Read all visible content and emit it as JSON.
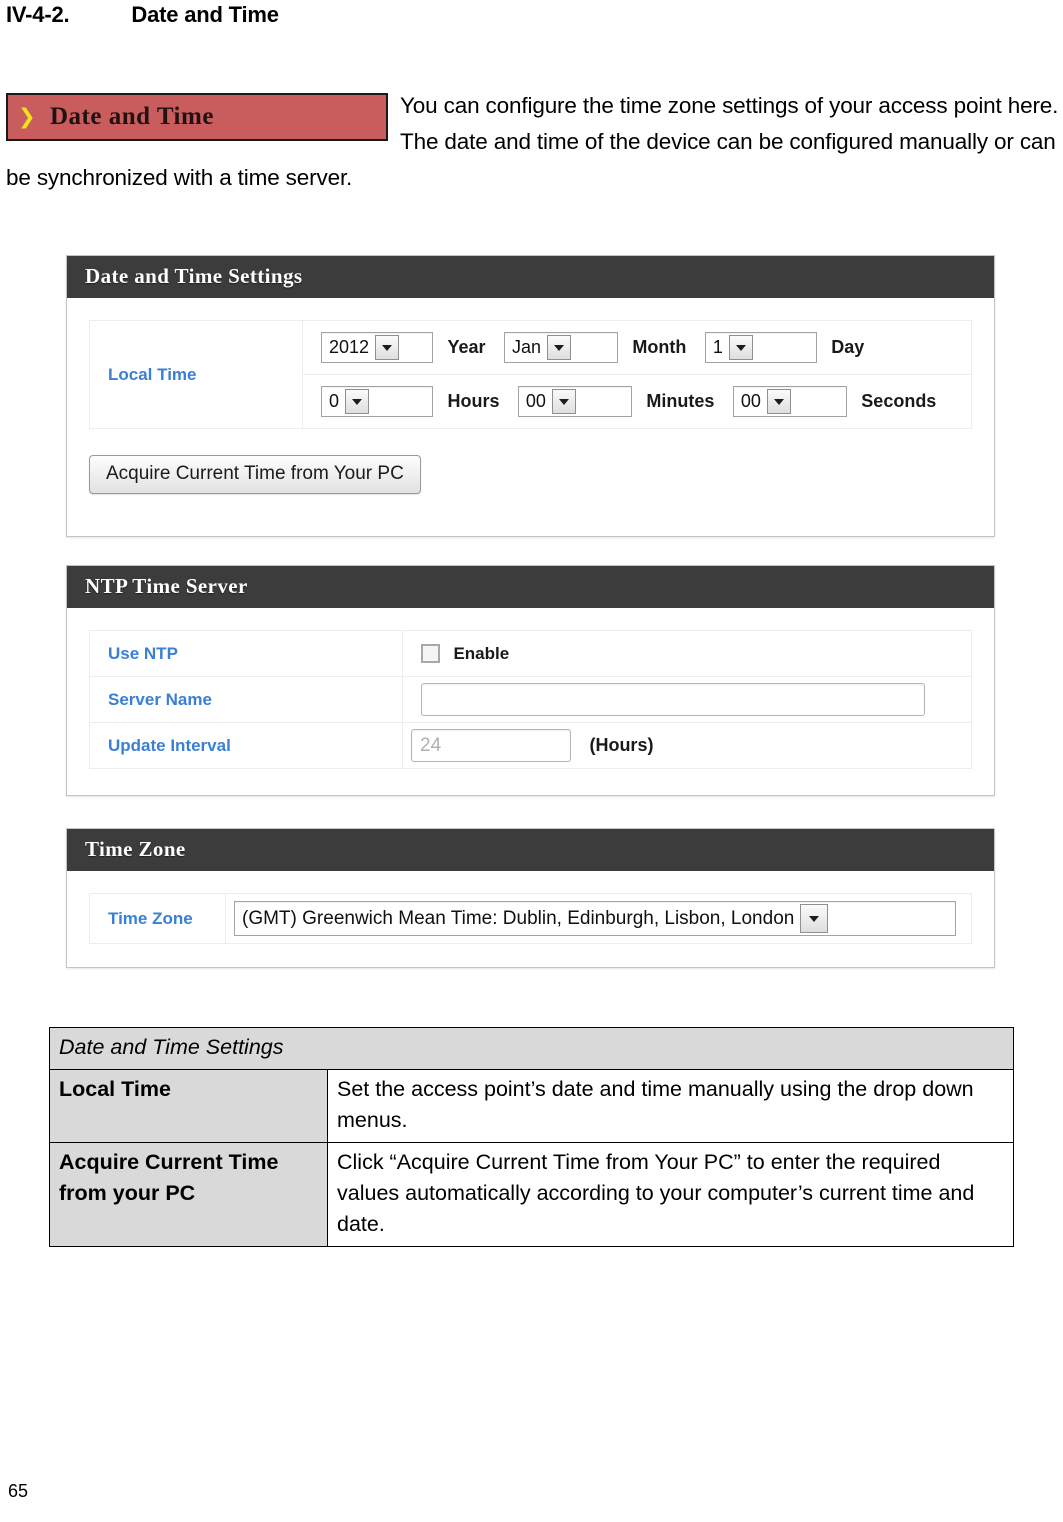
{
  "document": {
    "section_number": "IV-4-2.",
    "section_title": "Date and Time",
    "page_number": "65"
  },
  "intro": {
    "banner_chevron": "❯",
    "banner_label": "Date and Time",
    "paragraph": "You can configure the time zone settings of your access point here. The date and time of the device can be configured manually or can be synchronized with a time server."
  },
  "panels": {
    "date_time_settings": {
      "header": "Date and Time Settings",
      "local_time_label": "Local Time",
      "year_value": "2012",
      "year_unit": "Year",
      "month_value": "Jan",
      "month_unit": "Month",
      "day_value": "1",
      "day_unit": "Day",
      "hours_value": "0",
      "hours_unit": "Hours",
      "minutes_value": "00",
      "minutes_unit": "Minutes",
      "seconds_value": "00",
      "seconds_unit": "Seconds",
      "acquire_button": "Acquire Current Time from Your PC"
    },
    "ntp_time_server": {
      "header": "NTP Time Server",
      "use_ntp_label": "Use NTP",
      "enable_label": "Enable",
      "enable_checked": false,
      "server_name_label": "Server Name",
      "server_name_value": "",
      "update_interval_label": "Update Interval",
      "update_interval_placeholder": "24",
      "hours_note": "(Hours)"
    },
    "time_zone": {
      "header": "Time Zone",
      "row_label": "Time Zone",
      "selected_value": "(GMT) Greenwich Mean Time: Dublin, Edinburgh, Lisbon, London"
    }
  },
  "description_table": {
    "title": "Date and Time Settings",
    "rows": [
      {
        "key": "Local Time",
        "value": "Set the access point’s date and time manually using the drop down menus."
      },
      {
        "key": "Acquire Current Time from your PC",
        "value": "Click “Acquire Current Time from Your PC” to enter the required values automatically according to your computer’s current time and date."
      }
    ]
  },
  "colors": {
    "banner_red": "#c95d5d",
    "banner_chevron_yellow": "#f2e31a",
    "panel_header_dark": "#3c3c3c",
    "field_label_blue": "#3b7fd4",
    "desc_table_gray": "#d9d9d9"
  }
}
